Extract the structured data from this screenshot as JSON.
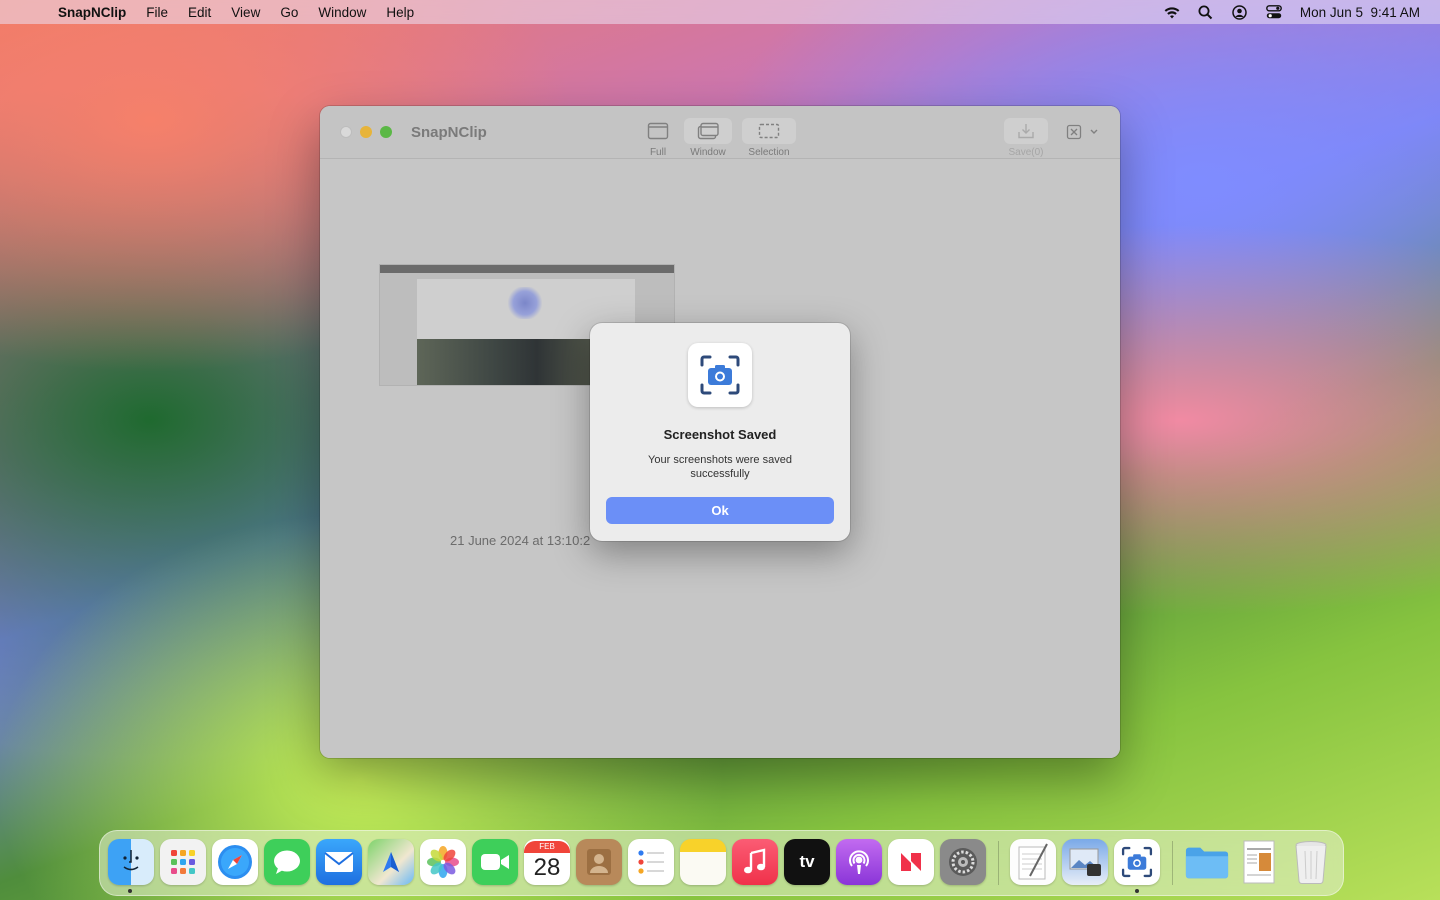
{
  "menubar": {
    "app_name": "SnapNClip",
    "items": [
      "File",
      "Edit",
      "View",
      "Go",
      "Window",
      "Help"
    ],
    "clock": "Mon Jun 5  9:41 AM",
    "icons": [
      "wifi-icon",
      "search-icon",
      "user-icon",
      "control-center-icon"
    ]
  },
  "window": {
    "title": "SnapNClip",
    "toolbar": {
      "full": "Full",
      "window": "Window",
      "selection": "Selection",
      "save": "Save(0)"
    },
    "screenshot_date": "21 June 2024 at 13:10:2"
  },
  "dialog": {
    "title": "Screenshot Saved",
    "message": "Your screenshots were saved successfully",
    "ok_label": "Ok"
  },
  "dock": {
    "feb_label": "FEB",
    "day_label": "28",
    "tv_label": "tv",
    "apps": [
      "Finder",
      "Launchpad",
      "Safari",
      "Messages",
      "Mail",
      "Maps",
      "Photos",
      "FaceTime",
      "Calendar",
      "Contacts",
      "Reminders",
      "Notes",
      "Music",
      "TV",
      "Podcasts",
      "News",
      "System Settings",
      "TextEdit",
      "Preview",
      "SnapNClip",
      "Folder",
      "Document",
      "Trash"
    ]
  },
  "colors": {
    "accent": "#6b8ff7",
    "window_bg": "#c8c8c8",
    "dialog_bg": "#ececec"
  }
}
